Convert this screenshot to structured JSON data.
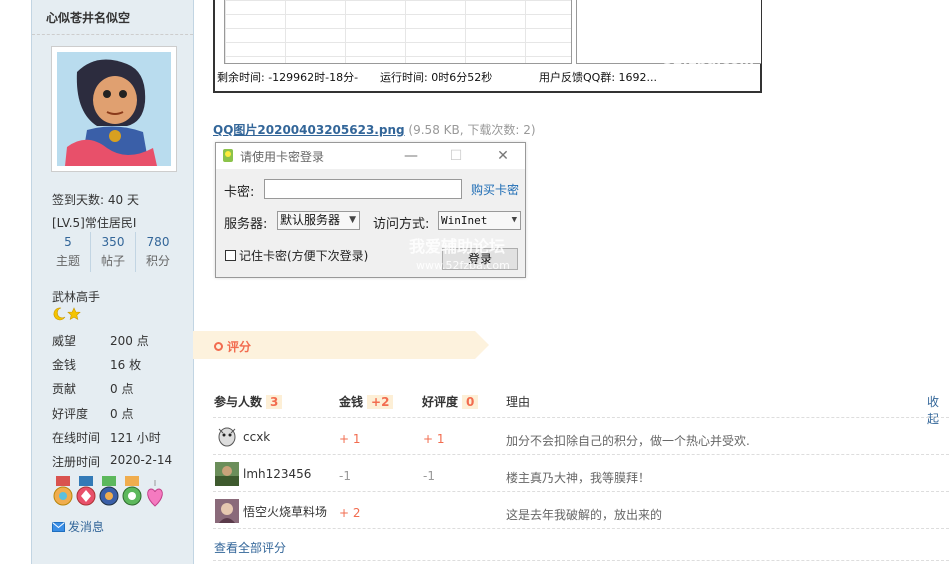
{
  "sidebar": {
    "author_name": "心似苍井名似空",
    "signin_days": "签到天数: 40 天",
    "level": "[LV.5]常住居民I",
    "stats": [
      {
        "num": "5",
        "label": "主题"
      },
      {
        "num": "350",
        "label": "帖子"
      },
      {
        "num": "780",
        "label": "积分"
      }
    ],
    "rank_title": "武林高手",
    "info": [
      {
        "k": "威望",
        "v": "200 点"
      },
      {
        "k": "金钱",
        "v": "16 枚"
      },
      {
        "k": "贡献",
        "v": "0 点"
      },
      {
        "k": "好评度",
        "v": "0 点"
      },
      {
        "k": "在线时间",
        "v": "121 小时"
      },
      {
        "k": "注册时间",
        "v": "2020-2-14"
      }
    ],
    "send_message": "发消息"
  },
  "screenshot_status": {
    "remaining": "剩余时间:  -129962时-18分-",
    "running": "运行时间: 0时6分52秒",
    "feedback": "用户反馈QQ群: 1692...",
    "watermark": "52fzba.com"
  },
  "attachment": {
    "filename": "QQ图片20200403205623.png",
    "meta": "(9.58 KB, 下载次数: 2)"
  },
  "dialog": {
    "title": "请使用卡密登录",
    "card_label": "卡密:",
    "buy_link": "购买卡密",
    "server_label": "服务器:",
    "server_value": "默认服务器",
    "access_label": "访问方式:",
    "access_value": "WinInet",
    "remember_label": "记住卡密(方便下次登录)",
    "login_button": "登录",
    "watermark": "我爱辅助论坛",
    "watermark_url": "www.52fzba.com"
  },
  "rating": {
    "title": "评分",
    "header": {
      "participants": "参与人数",
      "participants_count": "3",
      "money": "金钱",
      "money_total": "+2",
      "reputation": "好评度",
      "reputation_total": "0",
      "reason": "理由",
      "collapse": "收起"
    },
    "rows": [
      {
        "user": "ccxk",
        "money": "+ 1",
        "rep": "+ 1",
        "reason": "加分不会扣除自己的积分，做一个热心并受欢."
      },
      {
        "user": "lmh123456",
        "money": "-1",
        "rep": "-1",
        "reason": "楼主真乃大神，我等膜拜！"
      },
      {
        "user": "悟空火烧草料场",
        "money": "+ 2",
        "rep": "",
        "reason": "这是去年我破解的，放出来的"
      }
    ],
    "view_all": "查看全部评分"
  },
  "colors": {
    "sidebar_bg": "#e5edf2",
    "link": "#336699",
    "accent": "#f26c4f",
    "badge_bg": "#fdefd6",
    "banner_bg": "#fdf2dd"
  }
}
